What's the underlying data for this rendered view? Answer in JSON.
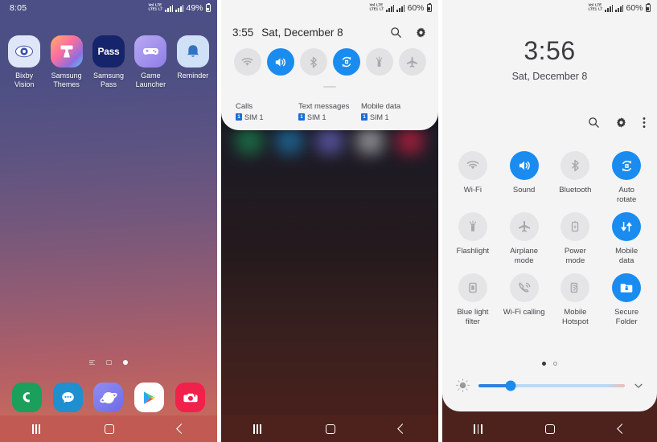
{
  "panel_home": {
    "statusbar": {
      "time": "8:05",
      "network_labels": [
        "VoLTE",
        "LTE1",
        "LTE",
        "LT"
      ],
      "battery_percent": "49%"
    },
    "apps": [
      {
        "label": "Bixby\nVision",
        "label_line1": "Bixby",
        "label_line2": "Vision",
        "icon": "bixby-vision-icon"
      },
      {
        "label": "Samsung Themes",
        "label_line1": "Samsung",
        "label_line2": "Themes",
        "icon": "samsung-themes-icon"
      },
      {
        "label": "Samsung Pass",
        "label_line1": "Samsung",
        "label_line2": "Pass",
        "icon": "samsung-pass-icon",
        "icon_text": "Pass"
      },
      {
        "label": "Game Launcher",
        "label_line1": "Game",
        "label_line2": "Launcher",
        "icon": "game-launcher-icon"
      },
      {
        "label": "Reminder",
        "label_line1": "Reminder",
        "label_line2": "",
        "icon": "reminder-icon"
      }
    ],
    "dock": [
      {
        "name": "phone-icon"
      },
      {
        "name": "messages-icon"
      },
      {
        "name": "internet-icon"
      },
      {
        "name": "play-store-icon"
      },
      {
        "name": "camera-icon"
      }
    ],
    "page_indicator": {
      "pages": 3,
      "active_index": 2
    },
    "navbar": {
      "recent": "recent-apps-icon",
      "home": "home-icon",
      "back": "back-icon"
    }
  },
  "panel_shade": {
    "statusbar": {
      "battery_percent": "60%"
    },
    "header": {
      "time": "3:55",
      "date": "Sat, December 8",
      "search": "search-icon",
      "settings": "gear-icon"
    },
    "toggles": [
      {
        "label": "Wi-Fi",
        "icon": "wifi-icon",
        "state": "off"
      },
      {
        "label": "Sound",
        "icon": "sound-icon",
        "state": "on"
      },
      {
        "label": "Bluetooth",
        "icon": "bluetooth-icon",
        "state": "off"
      },
      {
        "label": "Auto rotate",
        "icon": "auto-rotate-icon",
        "state": "on"
      },
      {
        "label": "Flashlight",
        "icon": "flashlight-icon",
        "state": "off"
      },
      {
        "label": "Airplane mode",
        "icon": "airplane-icon",
        "state": "off"
      }
    ],
    "sim_row": [
      {
        "title": "Calls",
        "value": "SIM 1",
        "badge": "1"
      },
      {
        "title": "Text messages",
        "value": "SIM 1",
        "badge": "1"
      },
      {
        "title": "Mobile data",
        "value": "SIM 1",
        "badge": "1"
      }
    ]
  },
  "panel_quick_settings": {
    "statusbar": {
      "battery_percent": "60%"
    },
    "clock": "3:56",
    "date": "Sat, December 8",
    "actions": [
      {
        "name": "search-icon"
      },
      {
        "name": "gear-icon"
      },
      {
        "name": "more-options-icon"
      }
    ],
    "tiles_row1": [
      {
        "label": "Wi-Fi",
        "label_line1": "Wi-Fi",
        "label_line2": "",
        "icon": "wifi-icon",
        "state": "off"
      },
      {
        "label": "Sound",
        "label_line1": "Sound",
        "label_line2": "",
        "icon": "sound-icon",
        "state": "on"
      },
      {
        "label": "Bluetooth",
        "label_line1": "Bluetooth",
        "label_line2": "",
        "icon": "bluetooth-icon",
        "state": "off"
      },
      {
        "label": "Auto rotate",
        "label_line1": "Auto",
        "label_line2": "rotate",
        "icon": "auto-rotate-icon",
        "state": "on"
      }
    ],
    "tiles_row2": [
      {
        "label": "Flashlight",
        "label_line1": "Flashlight",
        "label_line2": "",
        "icon": "flashlight-icon",
        "state": "off"
      },
      {
        "label": "Airplane mode",
        "label_line1": "Airplane",
        "label_line2": "mode",
        "icon": "airplane-icon",
        "state": "off"
      },
      {
        "label": "Power mode",
        "label_line1": "Power",
        "label_line2": "mode",
        "icon": "power-mode-icon",
        "state": "off"
      },
      {
        "label": "Mobile data",
        "label_line1": "Mobile",
        "label_line2": "data",
        "icon": "mobile-data-icon",
        "state": "on"
      }
    ],
    "tiles_row3": [
      {
        "label": "Blue light filter",
        "label_line1": "Blue light",
        "label_line2": "filter",
        "icon": "blue-light-filter-icon",
        "state": "off"
      },
      {
        "label": "Wi-Fi calling",
        "label_line1": "Wi-Fi calling",
        "label_line2": "",
        "icon": "wifi-calling-icon",
        "state": "off"
      },
      {
        "label": "Mobile Hotspot",
        "label_line1": "Mobile",
        "label_line2": "Hotspot",
        "icon": "mobile-hotspot-icon",
        "state": "off"
      },
      {
        "label": "Secure Folder",
        "label_line1": "Secure",
        "label_line2": "Folder",
        "icon": "secure-folder-icon",
        "state": "on"
      }
    ],
    "pager": {
      "pages": 2,
      "active_index": 0
    },
    "brightness": {
      "value_percent": 25,
      "low_icon": "brightness-icon",
      "expand_icon": "chevron-down-icon"
    }
  },
  "colors": {
    "accent_blue": "#1a8cf0",
    "tile_off_bg": "#e5e5e7",
    "tile_off_fg": "#a9a9ad",
    "shade_bg": "#f4f4f5",
    "navbar_dark": "#4d221c",
    "navbar_home": "#c15a52"
  }
}
